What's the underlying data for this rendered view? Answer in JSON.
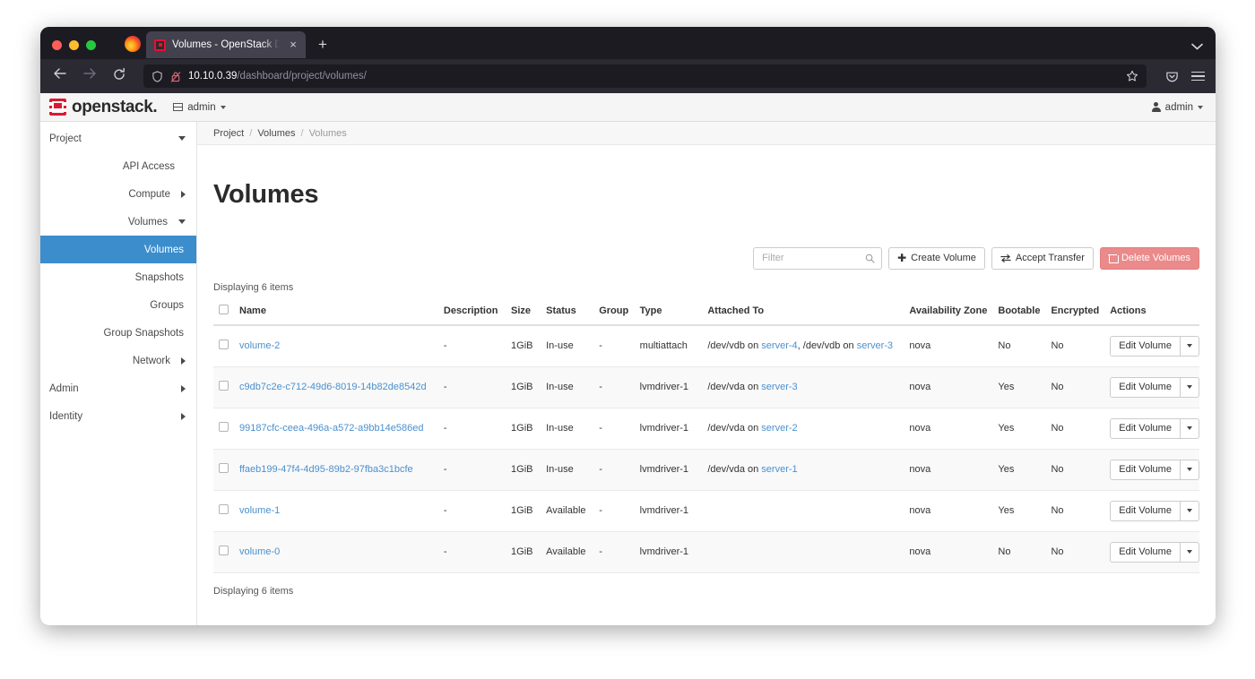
{
  "browser": {
    "tab": {
      "title": "Volumes - OpenStack Dashboard",
      "favicon": "openstack-favicon",
      "close_label": "×"
    },
    "new_tab_label": "+",
    "tab_list_chevron": "⌄",
    "nav": {
      "back_label": "←",
      "forward_label": "→",
      "reload_label": "⟳"
    },
    "url": {
      "host": "10.10.0.39",
      "path": "/dashboard/project/volumes/"
    }
  },
  "topbar": {
    "wordmark": "openstack.",
    "project_label": "admin",
    "user_label": "admin"
  },
  "sidebar": {
    "items": [
      {
        "label": "Project",
        "level": 0,
        "chevron": "down",
        "active": false
      },
      {
        "label": "API Access",
        "level": 1,
        "chevron": "none",
        "active": false
      },
      {
        "label": "Compute",
        "level": 1,
        "chevron": "right",
        "active": false
      },
      {
        "label": "Volumes",
        "level": 1,
        "chevron": "down",
        "active": false
      },
      {
        "label": "Volumes",
        "level": 2,
        "chevron": "none",
        "active": true
      },
      {
        "label": "Snapshots",
        "level": 2,
        "chevron": "none",
        "active": false
      },
      {
        "label": "Groups",
        "level": 2,
        "chevron": "none",
        "active": false
      },
      {
        "label": "Group Snapshots",
        "level": 2,
        "chevron": "none",
        "active": false
      },
      {
        "label": "Network",
        "level": 1,
        "chevron": "right",
        "active": false
      },
      {
        "label": "Admin",
        "level": 0,
        "chevron": "right",
        "active": false
      },
      {
        "label": "Identity",
        "level": 0,
        "chevron": "right",
        "active": false
      }
    ]
  },
  "breadcrumb": {
    "items": [
      "Project",
      "Volumes",
      "Volumes"
    ],
    "separator": "/"
  },
  "page": {
    "title": "Volumes",
    "count_top": "Displaying 6 items",
    "count_bottom": "Displaying 6 items"
  },
  "toolbar": {
    "filter_placeholder": "Filter",
    "filter_value": "",
    "create_label": "Create Volume",
    "create_icon": "plus-icon",
    "accept_label": "Accept Transfer",
    "accept_icon": "transfer-icon",
    "delete_label": "Delete Volumes",
    "delete_icon": "trash-icon",
    "delete_color": "#eb8a8a"
  },
  "table": {
    "columns": [
      "Name",
      "Description",
      "Size",
      "Status",
      "Group",
      "Type",
      "Attached To",
      "Availability Zone",
      "Bootable",
      "Encrypted",
      "Actions"
    ],
    "action_label": "Edit Volume",
    "rows": [
      {
        "name": "volume-2",
        "description": "-",
        "size": "1GiB",
        "status": "In-use",
        "group": "-",
        "type": "multiattach",
        "attachments": [
          {
            "device": "/dev/vdb on ",
            "server": "server-4",
            "trail": ", "
          },
          {
            "device": "/dev/vdb on ",
            "server": "server-3",
            "trail": ""
          }
        ],
        "availability_zone": "nova",
        "bootable": "No",
        "encrypted": "No"
      },
      {
        "name": "c9db7c2e-c712-49d6-8019-14b82de8542d",
        "description": "-",
        "size": "1GiB",
        "status": "In-use",
        "group": "-",
        "type": "lvmdriver-1",
        "attachments": [
          {
            "device": "/dev/vda on ",
            "server": "server-3",
            "trail": ""
          }
        ],
        "availability_zone": "nova",
        "bootable": "Yes",
        "encrypted": "No"
      },
      {
        "name": "99187cfc-ceea-496a-a572-a9bb14e586ed",
        "description": "-",
        "size": "1GiB",
        "status": "In-use",
        "group": "-",
        "type": "lvmdriver-1",
        "attachments": [
          {
            "device": "/dev/vda on ",
            "server": "server-2",
            "trail": ""
          }
        ],
        "availability_zone": "nova",
        "bootable": "Yes",
        "encrypted": "No"
      },
      {
        "name": "ffaeb199-47f4-4d95-89b2-97fba3c1bcfe",
        "description": "-",
        "size": "1GiB",
        "status": "In-use",
        "group": "-",
        "type": "lvmdriver-1",
        "attachments": [
          {
            "device": "/dev/vda on ",
            "server": "server-1",
            "trail": ""
          }
        ],
        "availability_zone": "nova",
        "bootable": "Yes",
        "encrypted": "No"
      },
      {
        "name": "volume-1",
        "description": "-",
        "size": "1GiB",
        "status": "Available",
        "group": "-",
        "type": "lvmdriver-1",
        "attachments": [],
        "availability_zone": "nova",
        "bootable": "Yes",
        "encrypted": "No"
      },
      {
        "name": "volume-0",
        "description": "-",
        "size": "1GiB",
        "status": "Available",
        "group": "-",
        "type": "lvmdriver-1",
        "attachments": [],
        "availability_zone": "nova",
        "bootable": "No",
        "encrypted": "No"
      }
    ]
  },
  "colors": {
    "accent_blue": "#3c8dcc",
    "link_blue": "#4a90cf",
    "openstack_red": "#da1a32",
    "danger": "#eb8a8a"
  }
}
